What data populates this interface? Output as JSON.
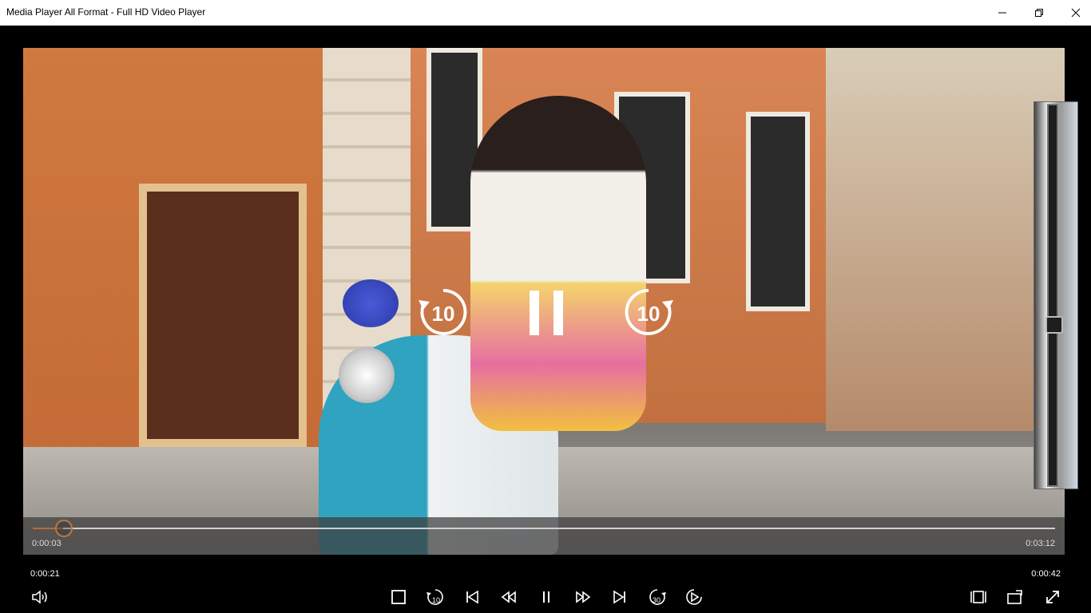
{
  "window": {
    "title": "Media Player All Format - Full HD Video Player",
    "minimize_icon": "minimize-icon",
    "maximize_icon": "restore-icon",
    "close_icon": "close-icon"
  },
  "overlay": {
    "rewind_label": "10",
    "forward_label": "10"
  },
  "seek": {
    "current_time": "0:00:03",
    "total_time": "0:03:12",
    "progress_fraction": 0.016
  },
  "volume": {
    "level_fraction": 0.44
  },
  "bottombar": {
    "time_left": "0:00:21",
    "time_right": "0:00:42",
    "rewind_badge": "10",
    "forward_badge": "30"
  },
  "colors": {
    "accent": "#c2773e",
    "background": "#000000",
    "titlebar": "#ffffff"
  }
}
